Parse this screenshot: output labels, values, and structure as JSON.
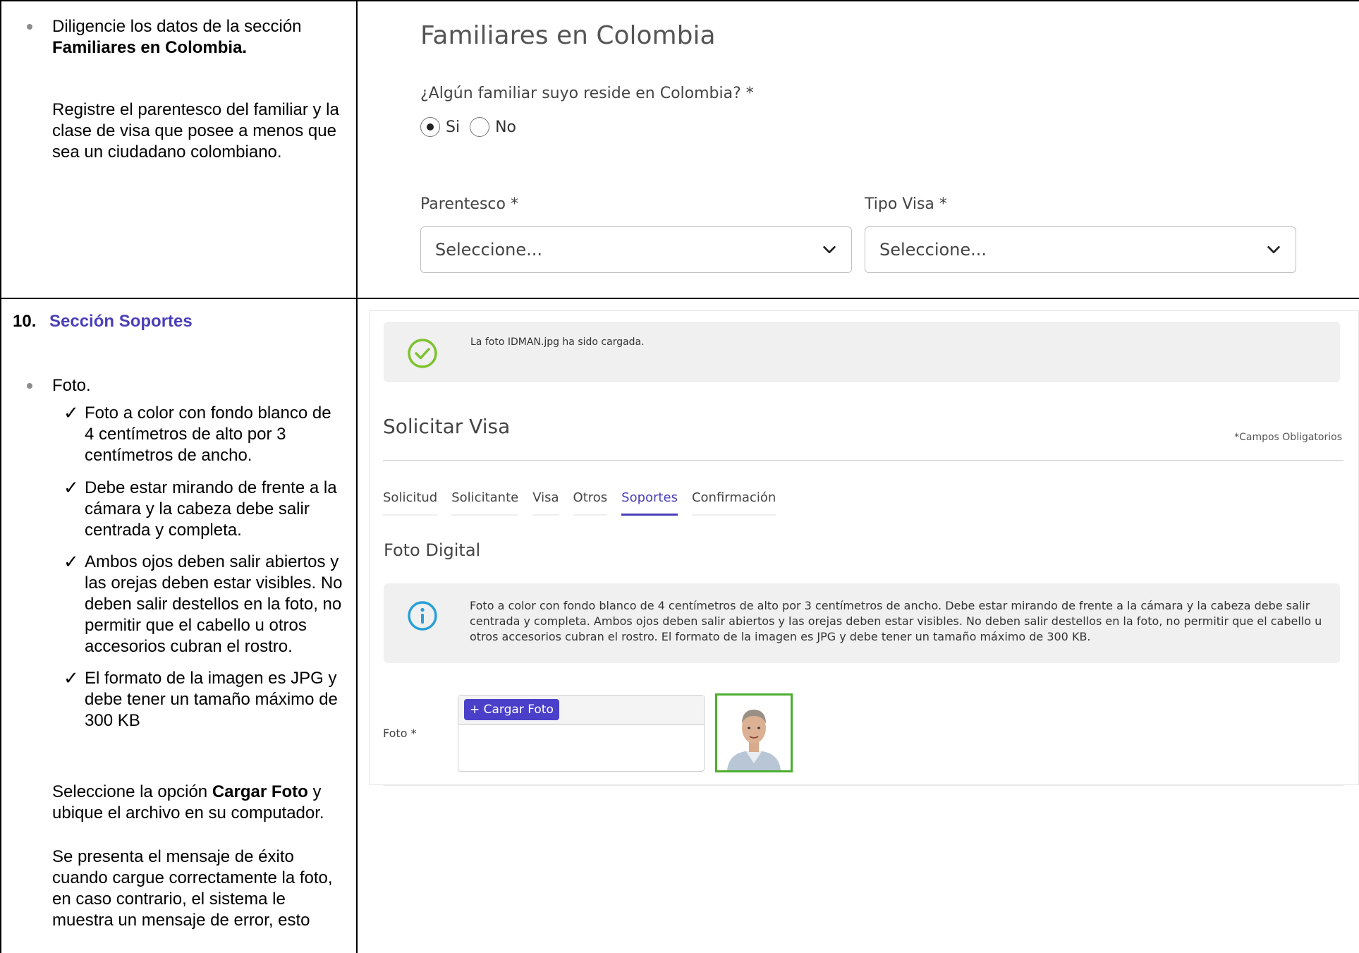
{
  "row1": {
    "instr_line1": "Diligencie los datos de la sección",
    "instr_line2_bold": "Familiares en Colombia.",
    "instr_p2": [
      "Registre el parentesco del familiar y la",
      "clase de visa que posee a menos que",
      "sea un ciudadano colombiano."
    ],
    "ui": {
      "title": "Familiares en Colombia",
      "question": "¿Algún familiar suyo reside en Colombia? *",
      "radio_si": "Si",
      "radio_no": "No",
      "selected": "Si",
      "parentesco_label": "Parentesco *",
      "tipo_visa_label": "Tipo Visa *",
      "parentesco_value": "Seleccione...",
      "tipo_visa_value": "Seleccione..."
    }
  },
  "row2": {
    "section_number": "10.",
    "section_title": "Sección Soportes",
    "bullet": "Foto.",
    "checks": [
      [
        "Foto a color con fondo blanco de",
        "4 centímetros de alto por 3",
        "centímetros de ancho."
      ],
      [
        "Debe estar mirando de frente a la",
        "cámara y la cabeza debe salir",
        "centrada y completa."
      ],
      [
        "Ambos ojos deben salir abiertos y",
        "las orejas deben estar visibles. No",
        "deben salir destellos en la foto, no",
        "permitir que el cabello u otros",
        "accesorios cubran el rostro."
      ],
      [
        "El formato de la imagen es JPG y",
        "debe tener un tamaño máximo de",
        "300 KB"
      ]
    ],
    "select_pre": "Seleccione la opción ",
    "select_bold": "Cargar Foto",
    "select_post": " y",
    "select_line2": "ubique el archivo en su computador.",
    "msg_lines": [
      "Se presenta el mensaje de éxito",
      "cuando cargue correctamente la foto,",
      "en caso contrario, el sistema le",
      "muestra un mensaje de error, esto"
    ],
    "ui": {
      "success_message": "La foto IDMAN.jpg ha sido cargada.",
      "title": "Solicitar Visa",
      "required_note": "*Campos Obligatorios",
      "tabs": [
        "Solicitud",
        "Solicitante",
        "Visa",
        "Otros",
        "Soportes",
        "Confirmación"
      ],
      "active_tab": "Soportes",
      "section_title": "Foto Digital",
      "info_text": "Foto a color con fondo blanco de 4 centímetros de alto por 3 centímetros de ancho. Debe estar mirando de frente a la cámara y la cabeza debe salir centrada y completa. Ambos ojos deben salir abiertos y las orejas deben estar visibles. No deben salir destellos en la foto, no permitir que el cabello u otros accesorios cubran el rostro. El formato de la imagen es JPG y debe tener un tamaño máximo de 300 KB.",
      "foto_label": "Foto *",
      "upload_button": "+ Cargar Foto"
    }
  },
  "colors": {
    "accent": "#4a3fb8",
    "success": "#7dc22e",
    "info": "#2a9fd6",
    "photo_border": "#4cae2e",
    "section_title": "#4a3fb8"
  }
}
